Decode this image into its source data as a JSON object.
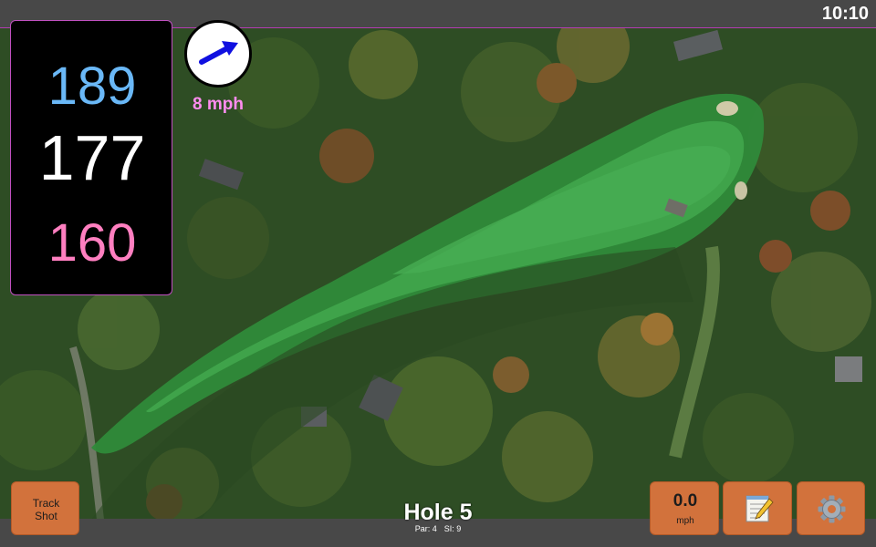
{
  "status_bar": {
    "time": "10:10"
  },
  "distances": {
    "back": "189",
    "middle": "177",
    "front": "160"
  },
  "wind": {
    "speed": "8 mph",
    "direction_icon": "arrow-icon"
  },
  "hole": {
    "title": "Hole 5",
    "par": "Par: 4",
    "stroke_index": "SI: 9"
  },
  "buttons": {
    "track_shot_line1": "Track",
    "track_shot_line2": "Shot",
    "speed_value": "0.0",
    "speed_unit": "mph",
    "notes_icon": "notepad-icon",
    "settings_icon": "gear-icon"
  },
  "colors": {
    "back_distance": "#6ab8f7",
    "middle_distance": "#ffffff",
    "front_distance": "#ff7fc0",
    "wind_speed": "#ff8cf0",
    "button": "#d2723c",
    "fairway": "#3f9a46"
  }
}
